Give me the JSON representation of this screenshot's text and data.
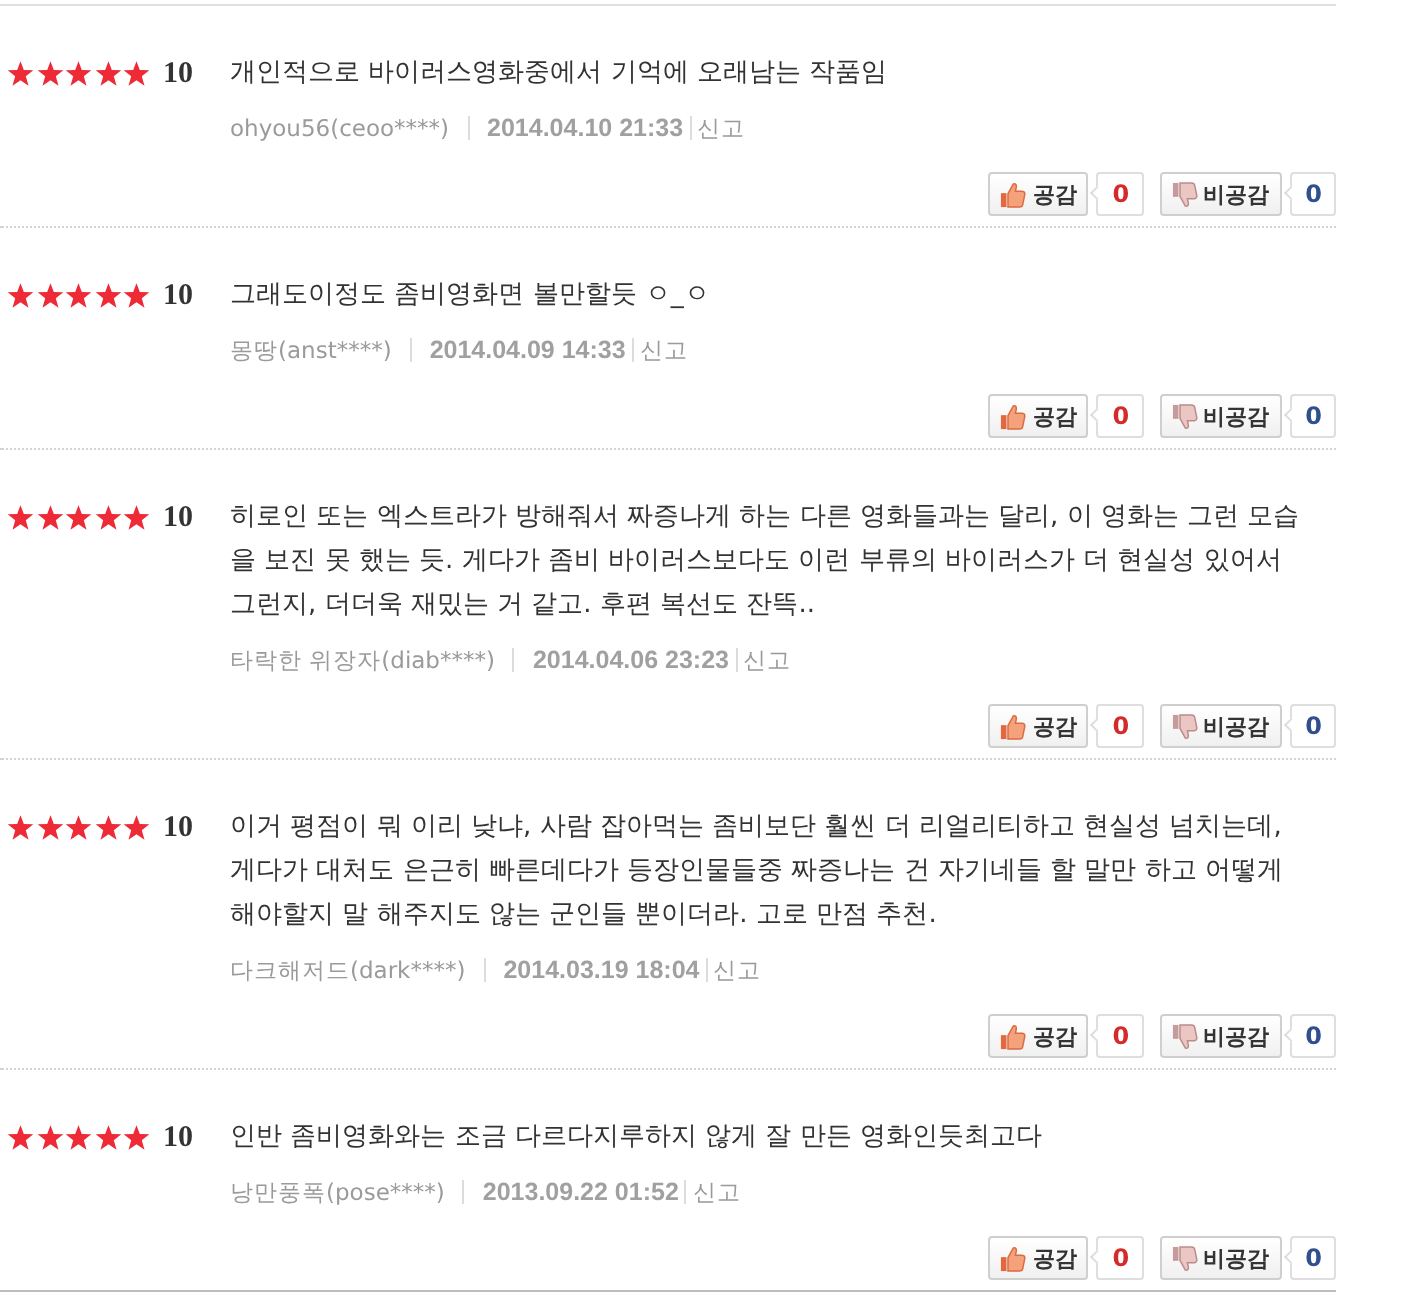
{
  "reviews": [
    {
      "stars": 5,
      "score": "10",
      "text": "개인적으로 바이러스영화중에서 기억에 오래남는 작품임",
      "author": "ohyou56(ceoo****)",
      "date": "2014.04.10 21:33",
      "report": "신고",
      "like_label": "공감",
      "like_count": "0",
      "dislike_label": "비공감",
      "dislike_count": "0"
    },
    {
      "stars": 5,
      "score": "10",
      "text": "그래도이정도 좀비영화면 볼만할듯 ㅇ_ㅇ",
      "author": "몽땅(anst****)",
      "date": "2014.04.09 14:33",
      "report": "신고",
      "like_label": "공감",
      "like_count": "0",
      "dislike_label": "비공감",
      "dislike_count": "0"
    },
    {
      "stars": 5,
      "score": "10",
      "text": "히로인 또는 엑스트라가 방해줘서 짜증나게 하는 다른 영화들과는 달리, 이 영화는 그런 모습을 보진 못 했는 듯. 게다가 좀비 바이러스보다도 이런 부류의 바이러스가 더 현실성 있어서 그런지, 더더욱 재밌는 거 같고. 후편 복선도 잔뜩..",
      "author": "타락한 위장자(diab****)",
      "date": "2014.04.06 23:23",
      "report": "신고",
      "like_label": "공감",
      "like_count": "0",
      "dislike_label": "비공감",
      "dislike_count": "0"
    },
    {
      "stars": 5,
      "score": "10",
      "text": "이거 평점이 뭐 이리 낮냐, 사람 잡아먹는 좀비보단 훨씬 더 리얼리티하고 현실성 넘치는데, 게다가 대처도 은근히 빠른데다가 등장인물들중 짜증나는 건 자기네들 할 말만 하고 어떻게 해야할지 말 해주지도 않는 군인들 뿐이더라. 고로 만점 추천.",
      "author": "다크해저드(dark****)",
      "date": "2014.03.19 18:04",
      "report": "신고",
      "like_label": "공감",
      "like_count": "0",
      "dislike_label": "비공감",
      "dislike_count": "0"
    },
    {
      "stars": 5,
      "score": "10",
      "text": "인반 좀비영화와는 조금 다르다지루하지 않게 잘 만든 영화인듯최고다",
      "author": "낭만풍폭(pose****)",
      "date": "2013.09.22 01:52",
      "report": "신고",
      "like_label": "공감",
      "like_count": "0",
      "dislike_label": "비공감",
      "dislike_count": "0"
    }
  ]
}
